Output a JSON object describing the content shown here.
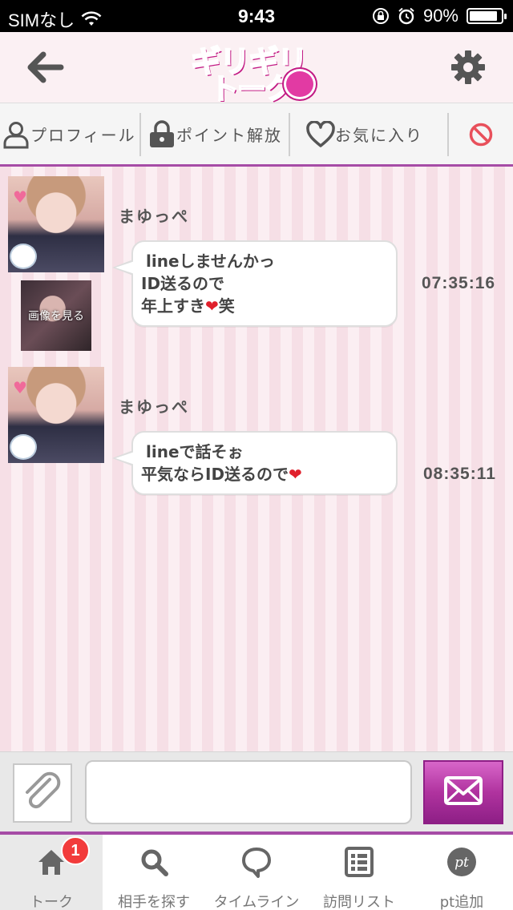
{
  "status_bar": {
    "carrier": "SIMなし",
    "time": "9:43",
    "battery_percent": "90%",
    "battery_level": 0.9
  },
  "header": {
    "logo_line1": "ギリギリ",
    "logo_line2": "トーク",
    "back_icon": "arrow-left-icon",
    "settings_icon": "gear-icon"
  },
  "actions": [
    {
      "label": "プロフィール",
      "icon": "user-icon"
    },
    {
      "label": "ポイント解放",
      "icon": "lock-icon"
    },
    {
      "label": "お気に入り",
      "icon": "heart-outline-icon"
    },
    {
      "label": "",
      "icon": "block-icon"
    }
  ],
  "messages": [
    {
      "sender": "まゆっぺ",
      "lines": [
        "lineしませんかっ",
        "ID送るので",
        "年上すき",
        "笑"
      ],
      "time": "07:35:16",
      "image_button": "画像を見る"
    },
    {
      "sender": "まゆっぺ",
      "lines": [
        "lineで話そぉ",
        "平気ならID送るので"
      ],
      "time": "08:35:11"
    }
  ],
  "compose": {
    "input_value": "",
    "attach_icon": "paperclip-icon",
    "send_icon": "envelope-icon"
  },
  "tabs": [
    {
      "label": "トーク",
      "icon": "home-icon",
      "badge": "1",
      "active": true
    },
    {
      "label": "相手を探す",
      "icon": "search-icon"
    },
    {
      "label": "タイムライン",
      "icon": "speech-bubble-icon"
    },
    {
      "label": "訪問リスト",
      "icon": "list-icon"
    },
    {
      "label": "pt追加",
      "icon": "pt-icon"
    }
  ],
  "colors": {
    "accent": "#a64ca6",
    "logo_pink": "#e23aa3",
    "badge_red": "#f23b3b",
    "block_red": "#e8505b"
  }
}
